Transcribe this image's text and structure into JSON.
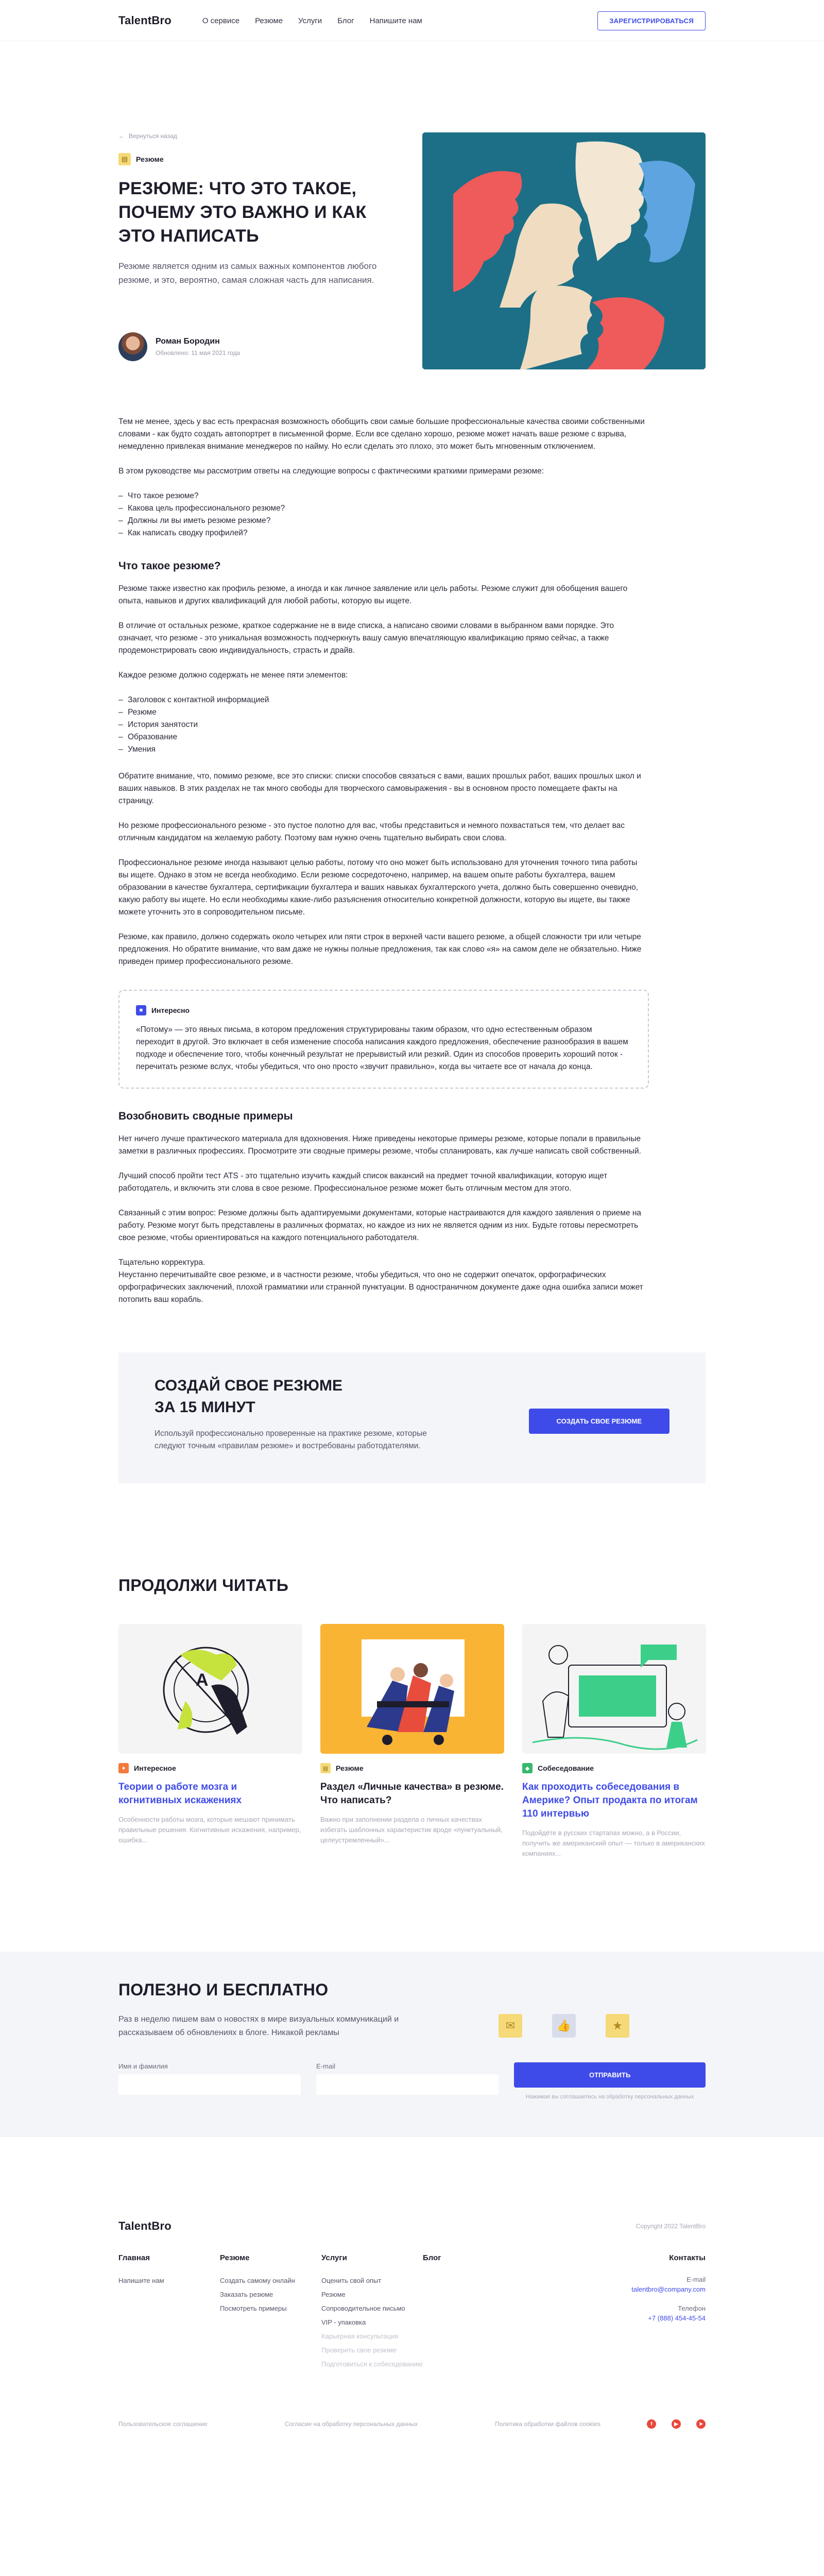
{
  "header": {
    "logo": "TalentBro",
    "nav": [
      "О сервисе",
      "Резюме",
      "Услуги",
      "Блог",
      "Напишите нам"
    ],
    "signup": "ЗАРЕГИСТРИРОВАТЬСЯ"
  },
  "hero": {
    "back": "Вернуться назад",
    "category": "Резюме",
    "title": "РЕЗЮМЕ: ЧТО ЭТО ТАКОЕ, ПОЧЕМУ ЭТО ВАЖНО И КАК ЭТО НАПИСАТЬ",
    "lead": "Резюме является одним из самых важных компонентов любого резюме, и это, вероятно, самая сложная часть для написания.",
    "author": "Роман Бородин",
    "date": "Обновлено: 11 мая 2021 года"
  },
  "article": {
    "p1": "Тем не менее, здесь у вас есть прекрасная возможность обобщить свои самые большие профессиональные качества своими собственными словами - как будто создать автопортрет в письменной форме. Если все сделано хорошо, резюме может начать ваше резюме с взрыва, немедленно привлекая внимание менеджеров по найму. Но если сделать это плохо, это может быть мгновенным отключением.",
    "p2": "В этом руководстве мы рассмотрим ответы на следующие вопросы с фактическими краткими примерами резюме:",
    "list1": [
      "Что такое резюме?",
      "Какова цель профессионального резюме?",
      "Должны ли вы иметь резюме резюме?",
      "Как написать сводку профилей?"
    ],
    "h1": "Что такое резюме?",
    "p3": "Резюме также известно как профиль резюме, а иногда и как личное заявление или цель работы. Резюме служит для обобщения вашего опыта, навыков и других квалификаций для любой работы, которую вы ищете.",
    "p4": "В отличие от остальных резюме, краткое содержание не в виде списка, а написано своими словами в выбранном вами порядке. Это означает, что резюме - это уникальная возможность подчеркнуть вашу самую впечатляющую квалификацию прямо сейчас, а также продемонстрировать свою индивидуальность, страсть и драйв.",
    "p5": "Каждое резюме должно содержать не менее пяти элементов:",
    "list2": [
      "Заголовок с контактной информацией",
      "Резюме",
      "История занятости",
      "Образование",
      "Умения"
    ],
    "p6": "Обратите внимание, что, помимо резюме, все это списки: списки способов связаться с вами, ваших прошлых работ, ваших прошлых школ и ваших навыков. В этих разделах не так много свободы для творческого самовыражения - вы в основном просто помещаете факты на страницу.",
    "p7": "Но резюме профессионального резюме - это пустое полотно для вас, чтобы представиться и немного похвастаться тем, что делает вас отличным кандидатом на желаемую работу. Поэтому вам нужно очень тщательно выбирать свои слова.",
    "p8": "Профессиональное резюме иногда называют целью работы, потому что оно может быть использовано для уточнения точного типа работы вы ищете. Однако в этом не всегда необходимо. Если резюме сосредоточено, например, на вашем опыте работы бухгалтера, вашем образовании в качестве бухгалтера, сертификации бухгалтера и ваших навыках бухгалтерского учета, должно быть совершенно очевидно, какую работу вы ищете. Но если необходимы какие-либо разъяснения относительно конкретной должности, которую вы ищете, вы также можете уточнить это в сопроводительном письме.",
    "p9": "Резюме, как правило, должно содержать около четырех или пяти строк в верхней части вашего резюме, а общей сложности три или четыре предложения. Но обратите внимание, что вам даже не нужны полные предложения, так как слово «я» на самом деле не обязательно. Ниже приведен пример профессионального резюме.",
    "callout_label": "Интересно",
    "callout_text": "«Потому» — это явных письма, в котором предложения структурированы таким образом, что одно естественным образом переходит в другой. Это включает в себя изменение способа написания каждого предложения, обеспечение разнообразия в вашем подходе и обеспечение того, чтобы конечный результат не прерывистый или резкий. Один из способов проверить хороший поток - перечитать резюме вслух, чтобы убедиться, что оно просто «звучит правильно», когда вы читаете все от начала до конца.",
    "h2": "Возобновить сводные примеры",
    "p10": "Нет ничего лучше практического материала для вдохновения. Ниже приведены некоторые примеры резюме, которые попали в правильные заметки в различных профессиях. Просмотрите эти сводные примеры резюме, чтобы спланировать, как лучше написать свой собственный.",
    "p11": "Лучший способ пройти тест ATS - это тщательно изучить каждый список вакансий на предмет точной квалификации, которую ищет работодатель, и включить эти слова в свое резюме. Профессиональное резюме может быть отличным местом для этого.",
    "p12": "Связанный с этим вопрос: Резюме должны быть адаптируемыми документами, которые настраиваются для каждого заявления о приеме на работу. Резюме могут быть представлены в различных форматах, но каждое из них не является одним из них. Будьте готовы пересмотреть свое резюме, чтобы ориентироваться на каждого потенциального работодателя.",
    "p13a": "Тщательно корректура.",
    "p13b": "Неустанно перечитывайте свое резюме, и в частности резюме, чтобы убедиться, что оно не содержит опечаток, орфографических орфографических заключений, плохой грамматики или странной пунктуации. В одностраничном документе даже одна ошибка записи может потопить ваш корабль."
  },
  "cta": {
    "title_line1": "СОЗДАЙ СВОЕ РЕЗЮМЕ",
    "title_line2": "ЗА 15 МИНУТ",
    "text": "Используй профессионально проверенные на практике резюме, которые следуют точным «правилам резюме» и востребованы работодателями.",
    "button": "СОЗДАТЬ СВОЕ РЕЗЮМЕ"
  },
  "readmore": {
    "title": "ПРОДОЛЖИ ЧИТАТЬ",
    "cards": [
      {
        "category": "Интересное",
        "title": "Теории о работе мозга и когнитивных искажениях",
        "desc": "Особенности работы мозга, которые мешают принимать правильные решения. Когнитивные искажения, например, ошибка..."
      },
      {
        "category": "Резюме",
        "title": "Раздел «Личные качества» в резюме. Что написать?",
        "desc": "Важно при заполнении раздела о личных качествах избегать шаблонных характеристик вроде «пунктуальный, целеустремленный»..."
      },
      {
        "category": "Собеседование",
        "title": "Как проходить собеседования в Америке? Опыт продакта по итогам 110 интервью",
        "desc": "Подойдёте в русских стартапах можно, а в России, получить же американский опыт — только в американских компаниях..."
      }
    ]
  },
  "newsletter": {
    "title": "ПОЛЕЗНО И БЕСПЛАТНО",
    "text": "Раз в неделю пишем вам о новостях в мире визуальных коммуникаций и рассказываем об обновлениях в блоге. Никакой рекламы",
    "name_label": "Имя и фамилия",
    "email_label": "E-mail",
    "button": "ОТПРАВИТЬ",
    "consent": "Нажимая вы соглашаетесь на обработку персональных данных"
  },
  "footer": {
    "logo": "TalentBro",
    "copyright": "Copyright 2022 TalentBro",
    "cols": [
      {
        "head": "Главная",
        "links": [
          "Напишите нам"
        ]
      },
      {
        "head": "Резюме",
        "links": [
          "Создать самому онлайн",
          "Заказать резюме",
          "Посмотреть примеры"
        ]
      },
      {
        "head": "Услуги",
        "links": [
          "Оценить свой опыт",
          "Резюме",
          "Сопроводительное письмо",
          "VIP - упаковка"
        ],
        "muted": [
          "Карьерная консультация",
          "Проверить свое резюме",
          "Подготовиться к собеседованию"
        ]
      },
      {
        "head": "Блог",
        "links": []
      }
    ],
    "contacts_head": "Контакты",
    "email_label": "E-mail",
    "email": "talentbro@company.com",
    "phone_label": "Телефон",
    "phone": "+7 (888) 454-45-54",
    "bottom": [
      "Пользовательское соглашение",
      "Согласие на обработку персональных данных",
      "Политика обработки файлов cookies"
    ]
  },
  "colors": {
    "accent": "#3f4be8",
    "resume_tag": "#f6d978",
    "interesting_tag": "#f47a3c",
    "interview_tag": "#38b76f"
  }
}
